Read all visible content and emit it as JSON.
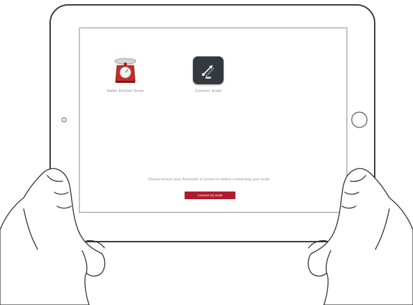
{
  "screen": {
    "apps": [
      {
        "label": "Salter Kitchen Scale",
        "icon": "kitchen-scale-icon"
      },
      {
        "label": "Connect Scale",
        "icon": "bluetooth-connect-icon"
      }
    ],
    "prompt": "Please ensure your Bluetooth is turned on before connecting your scale",
    "button_label": "Connect my scale"
  },
  "colors": {
    "accent": "#b01c2e",
    "connect_icon_bg": "#34393f",
    "scale_red": "#c92a2a"
  }
}
